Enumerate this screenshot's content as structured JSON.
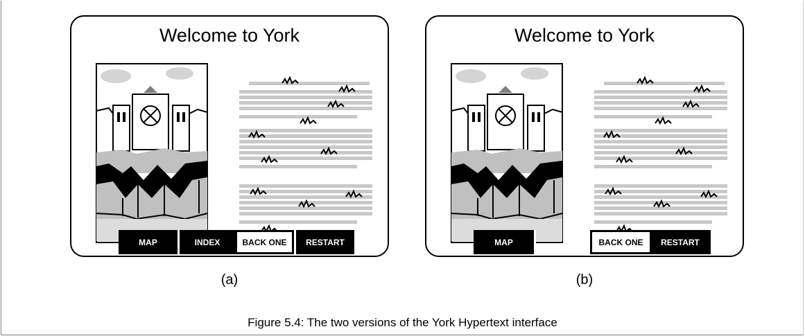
{
  "panels": [
    {
      "id": "a",
      "title": "Welcome to York",
      "buttons": [
        "MAP",
        "INDEX",
        "BACK ONE",
        "RESTART"
      ],
      "label": "(a)"
    },
    {
      "id": "b",
      "title": "Welcome to York",
      "buttons": [
        "MAP",
        "BACK ONE",
        "RESTART"
      ],
      "label": "(b)"
    }
  ],
  "caption": "Figure 5.4: The two versions of the York Hypertext interface",
  "colors": {
    "stroke": "#000000",
    "fill_gray": "#c0c0c0",
    "text_line_gray": "#c8c8c8"
  }
}
